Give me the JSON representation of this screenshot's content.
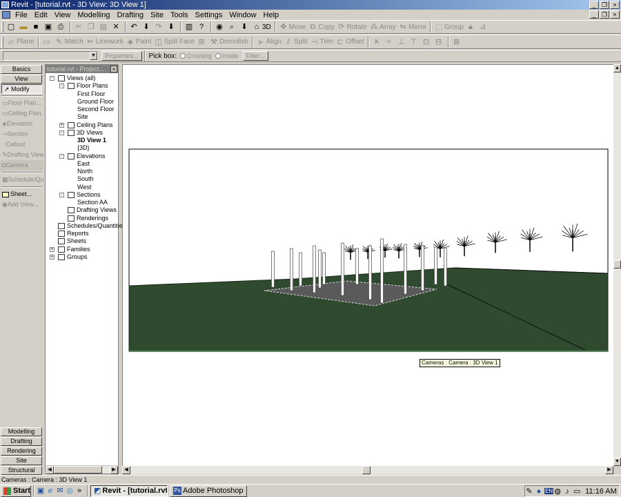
{
  "window": {
    "title": "Revit - [tutorial.rvt - 3D View: 3D View 1]",
    "controls": [
      "_",
      "❐",
      "×"
    ]
  },
  "doc_controls": [
    "_",
    "❐",
    "×"
  ],
  "menu": [
    "File",
    "Edit",
    "View",
    "Modelling",
    "Drafting",
    "Site",
    "Tools",
    "Settings",
    "Window",
    "Help"
  ],
  "toolbar1": {
    "view3d_label": "3D",
    "move": "Move",
    "copy": "Copy",
    "rotate": "Rotate",
    "array": "Array",
    "mirror": "Mirror",
    "group": "Group"
  },
  "toolbar2": {
    "plane": "Plane",
    "match": "Match",
    "linework": "Linework",
    "paint": "Paint",
    "split_face": "Split Face",
    "demolish": "Demolish",
    "align": "Align",
    "split": "Split",
    "trim": "Trim",
    "offset": "Offset"
  },
  "options_bar": {
    "type_select_value": "",
    "properties_label": "Properties...",
    "pick_box_label": "Pick box:",
    "crossing_label": "Crossing",
    "inside_label": "Inside",
    "filter_label": "Filter..."
  },
  "design_bar": {
    "top_tabs": [
      "Basics",
      "View"
    ],
    "tools": [
      {
        "label": "Modify",
        "enabled": true
      },
      {
        "label": "Floor Plan...",
        "enabled": false
      },
      {
        "label": "Ceiling Plan...",
        "enabled": false
      },
      {
        "label": "Elevation",
        "enabled": false
      },
      {
        "label": "Section",
        "enabled": false
      },
      {
        "label": "Callout",
        "enabled": false
      },
      {
        "label": "Drafting View",
        "enabled": false
      },
      {
        "label": "Camera",
        "enabled": false
      },
      {
        "label": "Schedule/Qu...",
        "enabled": false
      },
      {
        "label": "Sheet...",
        "enabled": true
      },
      {
        "label": "Add View...",
        "enabled": false
      }
    ],
    "bottom_tabs": [
      "Modelling",
      "Drafting",
      "Rendering",
      "Site",
      "Structural"
    ]
  },
  "project_browser": {
    "title": "tutorial.rvt - Project...",
    "items": [
      {
        "label": "Views (all)",
        "level": 0,
        "expander": "-",
        "bold": false
      },
      {
        "label": "Floor Plans",
        "level": 1,
        "expander": "-",
        "bold": false
      },
      {
        "label": "First Floor",
        "level": 2,
        "expander": "",
        "bold": false
      },
      {
        "label": "Ground Floor",
        "level": 2,
        "expander": "",
        "bold": false
      },
      {
        "label": "Second Floor",
        "level": 2,
        "expander": "",
        "bold": false
      },
      {
        "label": "Site",
        "level": 2,
        "expander": "",
        "bold": false
      },
      {
        "label": "Ceiling Plans",
        "level": 1,
        "expander": "+",
        "bold": false
      },
      {
        "label": "3D Views",
        "level": 1,
        "expander": "-",
        "bold": false
      },
      {
        "label": "3D View 1",
        "level": 2,
        "expander": "",
        "bold": true
      },
      {
        "label": "{3D}",
        "level": 2,
        "expander": "",
        "bold": false
      },
      {
        "label": "Elevations",
        "level": 1,
        "expander": "-",
        "bold": false
      },
      {
        "label": "East",
        "level": 2,
        "expander": "",
        "bold": false
      },
      {
        "label": "North",
        "level": 2,
        "expander": "",
        "bold": false
      },
      {
        "label": "South",
        "level": 2,
        "expander": "",
        "bold": false
      },
      {
        "label": "West",
        "level": 2,
        "expander": "",
        "bold": false
      },
      {
        "label": "Sections",
        "level": 1,
        "expander": "-",
        "bold": false
      },
      {
        "label": "Section AA",
        "level": 2,
        "expander": "",
        "bold": false
      },
      {
        "label": "Drafting Views",
        "level": 1,
        "expander": "",
        "bold": false
      },
      {
        "label": "Renderings",
        "level": 1,
        "expander": "",
        "bold": false
      },
      {
        "label": "Schedules/Quantities",
        "level": 0,
        "expander": "",
        "bold": false
      },
      {
        "label": "Reports",
        "level": 0,
        "expander": "",
        "bold": false
      },
      {
        "label": "Sheets",
        "level": 0,
        "expander": "",
        "bold": false
      },
      {
        "label": "Families",
        "level": 0,
        "expander": "+",
        "bold": false
      },
      {
        "label": "Groups",
        "level": 0,
        "expander": "+",
        "bold": false
      }
    ]
  },
  "viewport": {
    "tooltip": "Cameras : Camera : 3D View 1",
    "ground_color": "#2f4a2f",
    "sky_color": "#ffffff",
    "frame_color": "#3a6a3a"
  },
  "status_bar": {
    "text": "Cameras : Camera : 3D View 1"
  },
  "taskbar": {
    "start_label": "Start",
    "tasks": [
      {
        "label": "Revit - [tutorial.rvt ...",
        "active": true
      },
      {
        "label": "Adobe Photoshop",
        "active": false
      }
    ],
    "tray_lang": "EN",
    "clock": "11:16 AM"
  }
}
